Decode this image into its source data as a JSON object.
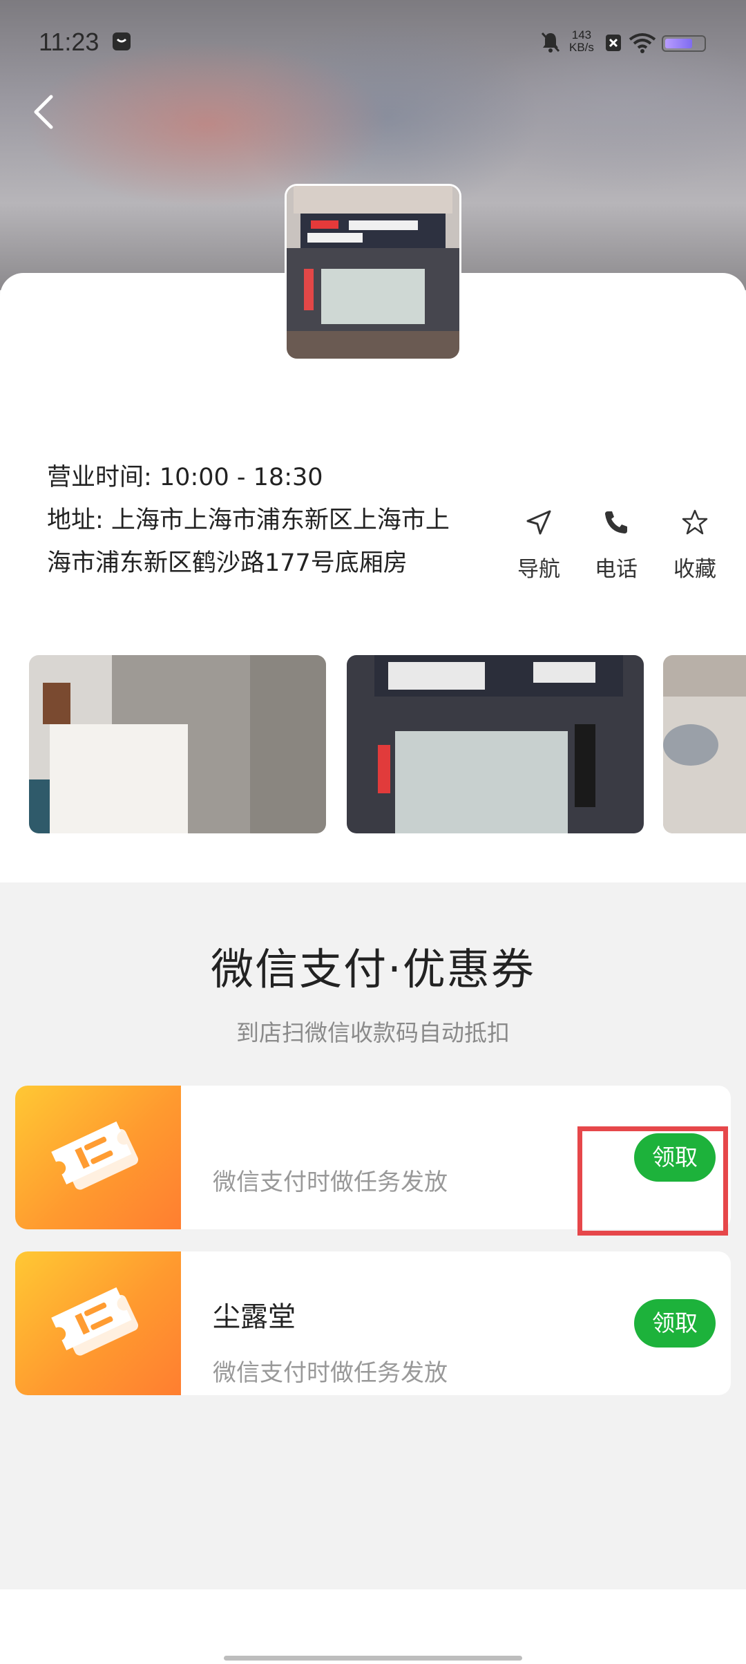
{
  "status_bar": {
    "time": "11:23",
    "speed_value": "143",
    "speed_unit": "KB/s",
    "battery_level": 0.72
  },
  "store": {
    "hours": "营业时间: 10:00 - 18:30",
    "address": "地址: 上海市上海市浦东新区上海市上海市浦东新区鹤沙路177号底厢房",
    "actions": [
      {
        "label": "导航",
        "icon": "navigation-icon"
      },
      {
        "label": "电话",
        "icon": "phone-icon"
      },
      {
        "label": "收藏",
        "icon": "star-icon"
      }
    ]
  },
  "coupons_section": {
    "title": "微信支付·优惠券",
    "subtitle": "到店扫微信收款码自动抵扣",
    "items": [
      {
        "name": "",
        "description": "微信支付时做任务发放",
        "button": "领取"
      },
      {
        "name": "尘露堂",
        "description": "微信支付时做任务发放",
        "button": "领取"
      }
    ]
  },
  "colors": {
    "accent_green": "#1db23b",
    "coupon_orange": "#ff9a2f",
    "highlight_red": "#e6474a"
  }
}
